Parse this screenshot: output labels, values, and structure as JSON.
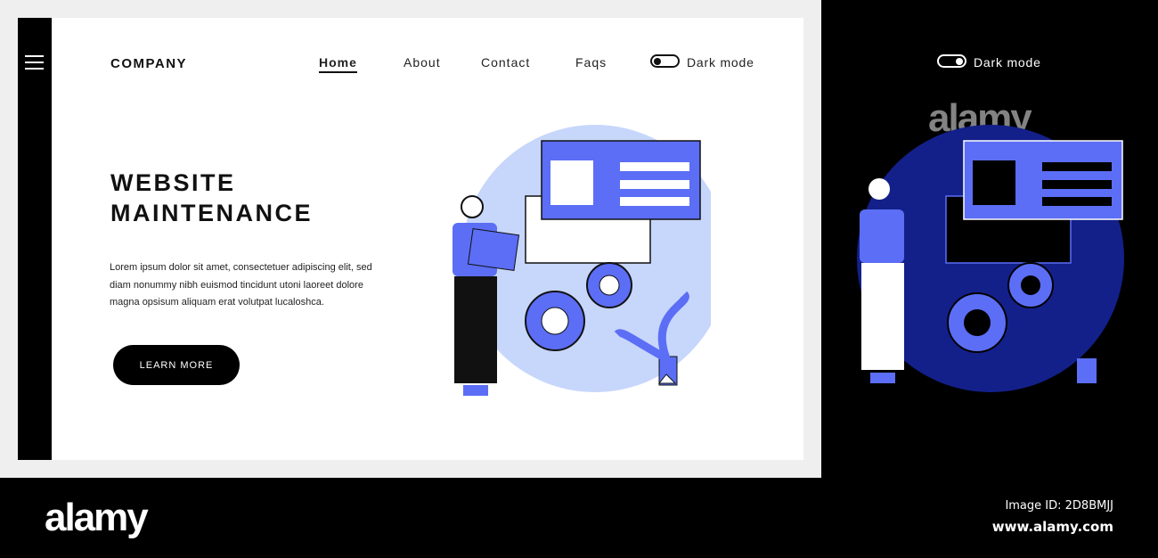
{
  "header": {
    "logo": "COMPANY",
    "nav": [
      "Home",
      "About",
      "Contact",
      "Faqs"
    ],
    "dark_mode_label": "Dark mode"
  },
  "hero": {
    "title_line1": "WEBSITE",
    "title_line2": "MAINTENANCE",
    "body": "Lorem ipsum dolor sit amet, consectetuer adipiscing elit, sed diam nonummy nibh euismod tincidunt utoni laoreet dolore magna opsisum aliquam erat volutpat lucaloshca.",
    "button": "LEARN MORE"
  },
  "dark_panel": {
    "dark_mode_label": "Dark mode",
    "watermark": "alamy"
  },
  "footer": {
    "brand": "alamy",
    "image_id": "Image ID: 2D8BMJJ",
    "url": "www.alamy.com"
  },
  "colors": {
    "accent": "#5b6ef5",
    "light_circle": "#c7d6fb",
    "dark_circle": "#13208a"
  }
}
